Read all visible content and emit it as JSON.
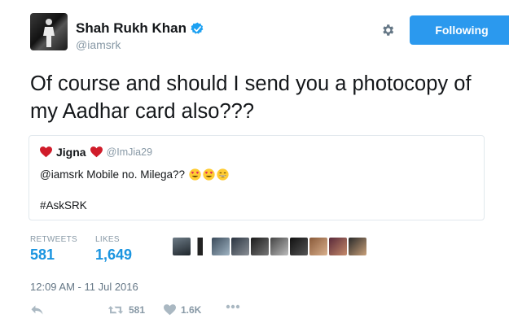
{
  "author": {
    "display_name": "Shah Rukh Khan",
    "handle": "@iamsrk",
    "verified": true
  },
  "follow_button_label": "Following",
  "tweet_text": "Of course and should I send you a photocopy of my Aadhar card also???",
  "quoted_tweet": {
    "display_name": "Jigna",
    "handle": "@ImJia29",
    "text": "@iamsrk Mobile no. Milega??",
    "emojis": [
      "heart-eyes-emoji",
      "heart-eyes-emoji",
      "grinning-emoji"
    ],
    "hashtag": "#AskSRK"
  },
  "stats": {
    "retweets_label": "RETWEETS",
    "retweets_value": "581",
    "likes_label": "LIKES",
    "likes_value": "1,649"
  },
  "liker_avatar_count_shown": 10,
  "timestamp": "12:09 AM - 11 Jul 2016",
  "actions": {
    "reply_icon": "reply-icon",
    "retweet_count": "581",
    "like_count": "1.6K",
    "more_icon": "more-icon"
  },
  "colors": {
    "accent": "#2b99ee",
    "link_blue": "#1b95e0",
    "muted": "#8899a6",
    "heart_red": "#d01c2a"
  }
}
